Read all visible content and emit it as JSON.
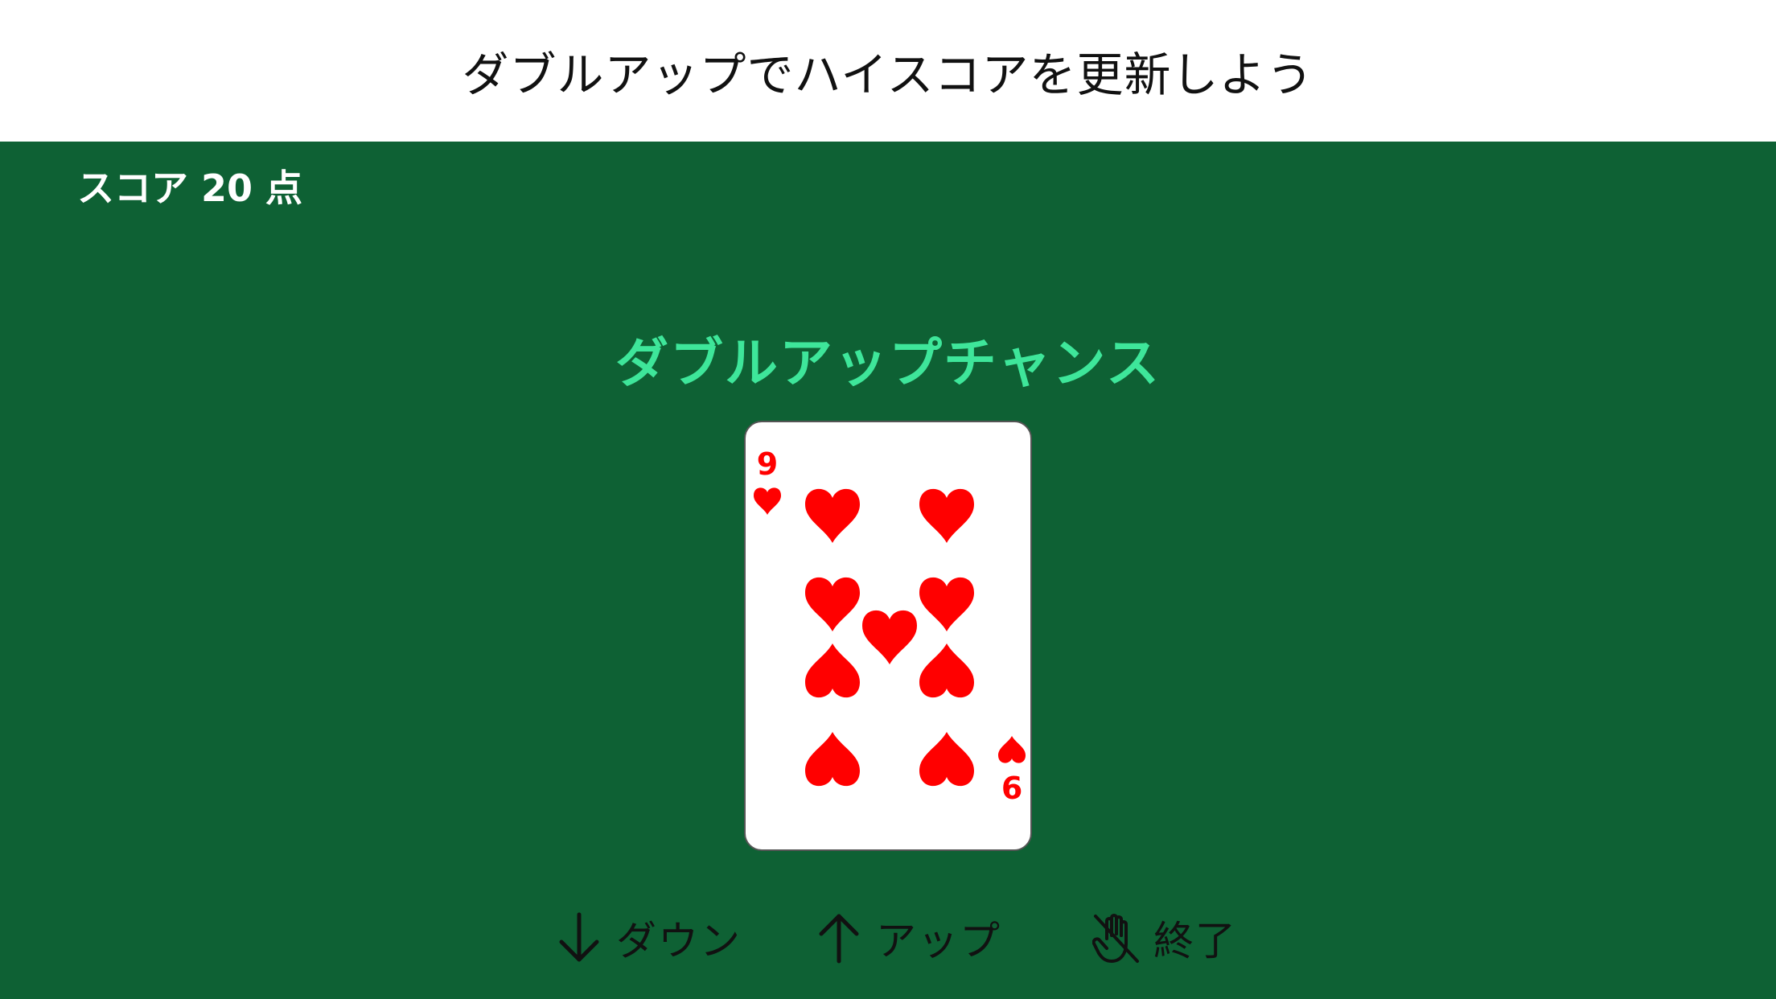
{
  "header": {
    "title": "ダブルアップでハイスコアを更新しよう"
  },
  "game": {
    "score_label": "スコア 20 点",
    "chance_title": "ダブルアップチャンス",
    "card": {
      "rank": "9",
      "suit": "heart",
      "color": "#ff0000"
    }
  },
  "controls": {
    "down": {
      "label": "ダウン",
      "icon": "arrow-down-icon"
    },
    "up": {
      "label": "アップ",
      "icon": "arrow-up-icon"
    },
    "quit": {
      "label": "終了",
      "icon": "hand-slash-icon"
    }
  },
  "colors": {
    "table": "#0e6134",
    "chance": "#3ee69a",
    "header_bg": "#ffffff"
  }
}
